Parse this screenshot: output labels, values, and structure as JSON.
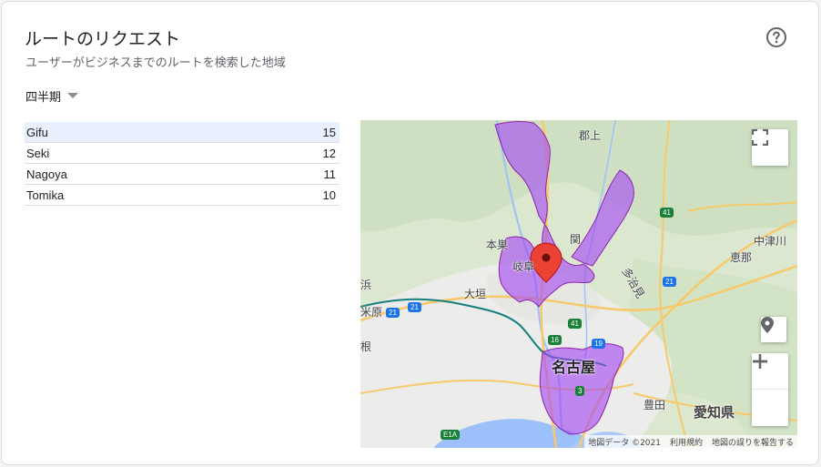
{
  "header": {
    "title": "ルートのリクエスト",
    "subtitle": "ユーザーがビジネスまでのルートを検索した地域"
  },
  "period": {
    "label": "四半期"
  },
  "table": {
    "rows": [
      {
        "name": "Gifu",
        "count": "15"
      },
      {
        "name": "Seki",
        "count": "12"
      },
      {
        "name": "Nagoya",
        "count": "11"
      },
      {
        "name": "Tomika",
        "count": "10"
      }
    ]
  },
  "map": {
    "labels": {
      "gujo": "郡上",
      "seki": "関",
      "motosu": "本巣",
      "gifu": "岐阜",
      "ogaki": "大垣",
      "tajimi": "多治見",
      "nakatsugawa": "中津川",
      "ena": "恵那",
      "nagoya": "名古屋",
      "toyota": "豊田",
      "aichi": "愛知県",
      "hama": "浜",
      "hara": "米原",
      "hiko": "根"
    },
    "shields": {
      "r41a": "41",
      "r41b": "41",
      "r21a": "21",
      "r21b": "21",
      "r21c": "21",
      "r16": "16",
      "r19": "19",
      "r3": "3",
      "e1a": "E1A"
    },
    "attribution": {
      "data": "地図データ ©2021",
      "terms": "利用規約",
      "report": "地図の誤りを報告する"
    },
    "colors": {
      "region": "#a142f4",
      "marker": "#ea4335",
      "water": "#9cc0f9",
      "road": "#f7c96b",
      "rail": "#17807e"
    }
  }
}
